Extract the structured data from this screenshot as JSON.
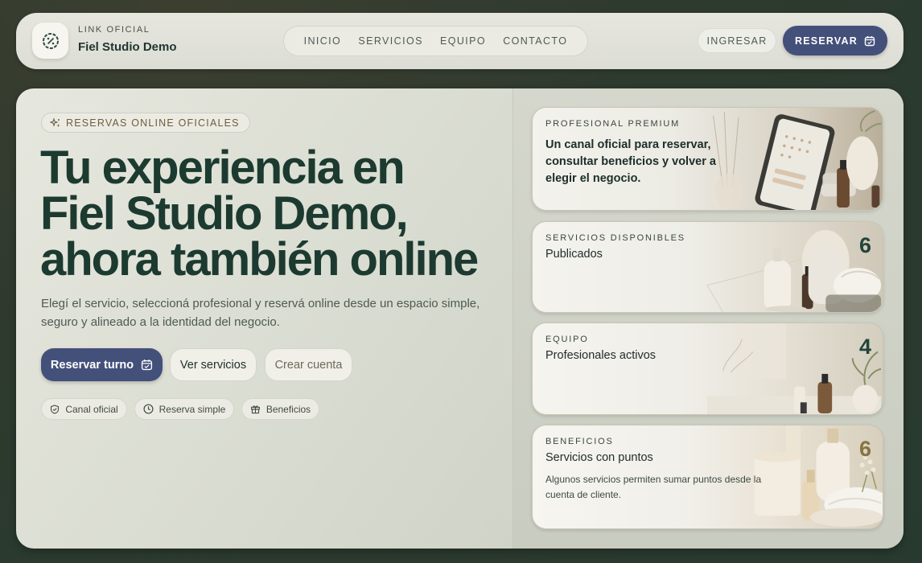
{
  "header": {
    "brand_kicker": "LINK OFICIAL",
    "brand_name": "Fiel Studio Demo",
    "nav": [
      "INICIO",
      "SERVICIOS",
      "EQUIPO",
      "CONTACTO"
    ],
    "login_label": "INGRESAR",
    "book_label": "RESERVAR"
  },
  "hero": {
    "badge": "RESERVAS ONLINE OFICIALES",
    "title_lines": [
      "Tu experiencia en",
      "Fiel Studio Demo,",
      "ahora también online"
    ],
    "subtitle": "Elegí el servicio, seleccioná profesional y reservá online desde un espacio simple, seguro y alineado a la identidad del negocio.",
    "primary_button": "Reservar turno",
    "services_button": "Ver servicios",
    "account_button": "Crear cuenta",
    "chips": [
      "Canal oficial",
      "Reserva simple",
      "Beneficios"
    ]
  },
  "cards": {
    "premium": {
      "kicker": "PROFESIONAL PREMIUM",
      "text": "Un canal oficial para reservar, consultar beneficios y volver a elegir el negocio."
    },
    "services": {
      "kicker": "SERVICIOS DISPONIBLES",
      "label": "Publicados",
      "count": "6"
    },
    "team": {
      "kicker": "EQUIPO",
      "label": "Profesionales activos",
      "count": "4"
    },
    "benefits": {
      "kicker": "BENEFICIOS",
      "label": "Servicios con puntos",
      "count": "6",
      "description": "Algunos servicios permiten sumar puntos desde la cuenta de cliente."
    }
  },
  "colors": {
    "primary": "#43507a",
    "heading": "#1c3a30",
    "accent_gold": "#847542"
  }
}
